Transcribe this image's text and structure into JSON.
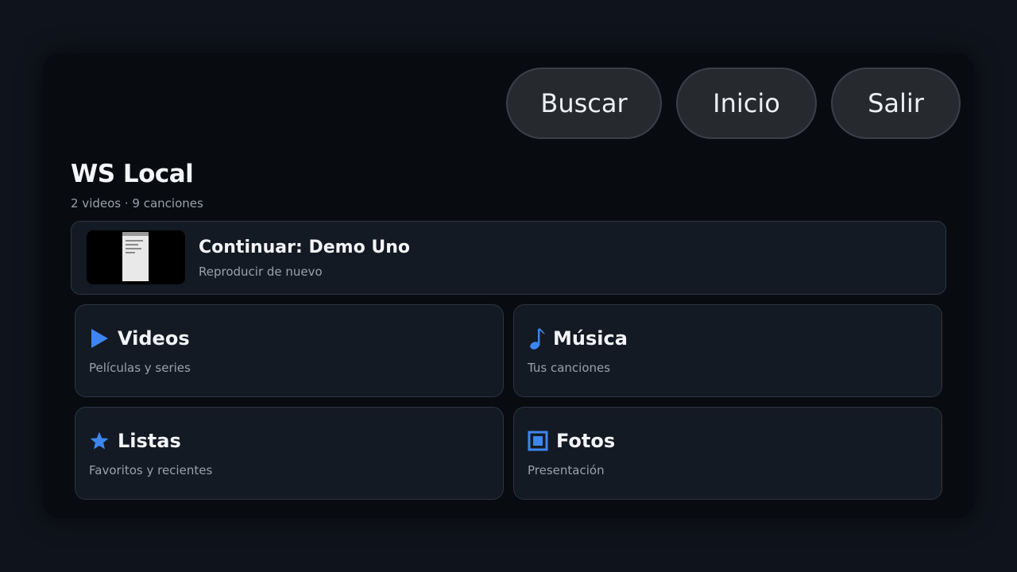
{
  "header": {
    "buttons": [
      {
        "label": "Buscar"
      },
      {
        "label": "Inicio"
      },
      {
        "label": "Salir"
      }
    ]
  },
  "library": {
    "title": "WS Local",
    "summary": "2 videos · 9 canciones"
  },
  "continue": {
    "title": "Continuar: Demo Uno",
    "subtitle": "Reproducir de nuevo"
  },
  "tiles": [
    {
      "title": "Videos",
      "subtitle": "Películas y series",
      "icon": "play-icon"
    },
    {
      "title": "Música",
      "subtitle": "Tus canciones",
      "icon": "music-note-icon"
    },
    {
      "title": "Listas",
      "subtitle": "Favoritos y recientes",
      "icon": "star-icon"
    },
    {
      "title": "Fotos",
      "subtitle": "Presentación",
      "icon": "photo-frame-icon"
    }
  ],
  "colors": {
    "accent": "#3d86f0",
    "background": "#0f131b",
    "panel": "#080b10",
    "card": "#141a24",
    "button": "#26292e"
  }
}
